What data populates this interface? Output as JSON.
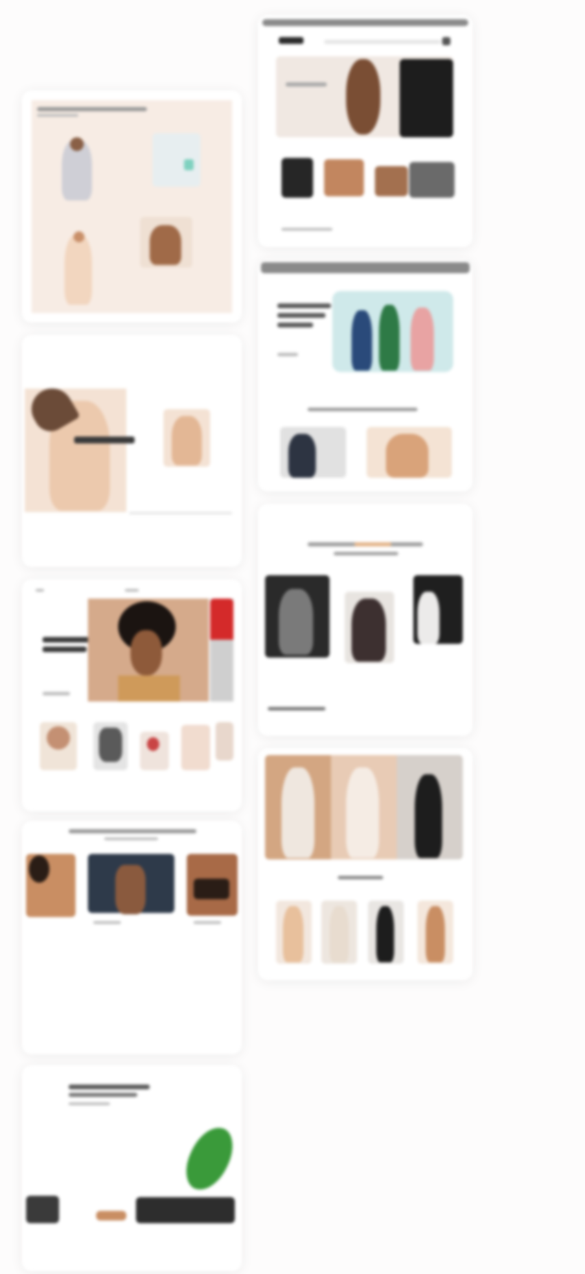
{
  "page": {
    "background": "#fdfcfc"
  },
  "colors": {
    "beige": "#f3e6dc",
    "skin": "#c9906a",
    "dark": "#1d1d1d",
    "teal": "#cfe9ea",
    "red": "#d42a2a",
    "green": "#3a9a3a",
    "mint": "#7fd1bf",
    "gray_bar": "#8a8a8a"
  },
  "cards": [
    {
      "id": "product-grid-card"
    },
    {
      "id": "header-hero-card"
    },
    {
      "id": "promo-banner-card"
    },
    {
      "id": "colorful-collection-card"
    },
    {
      "id": "portrait-hero-card"
    },
    {
      "id": "lookbook-card"
    },
    {
      "id": "category-row-card"
    },
    {
      "id": "editorial-grid-card"
    },
    {
      "id": "leaf-promo-card"
    }
  ]
}
